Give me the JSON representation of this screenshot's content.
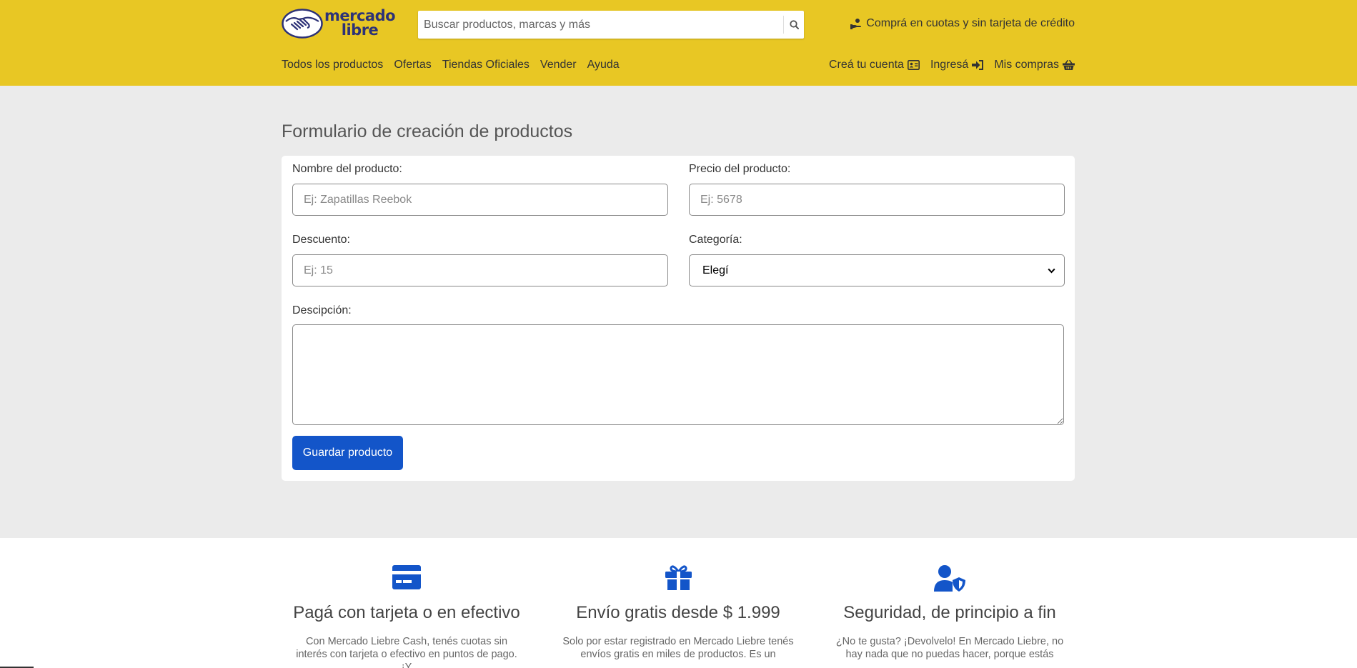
{
  "header": {
    "logo_line1": "mercado",
    "logo_line2": "libre",
    "search_placeholder": "Buscar productos, marcas y más",
    "promo_text": "Comprá en cuotas y sin tarjeta de crédito",
    "nav_left": [
      "Todos los productos",
      "Ofertas",
      "Tiendas Oficiales",
      "Vender",
      "Ayuda"
    ],
    "nav_right": {
      "create_account": "Creá tu cuenta",
      "login": "Ingresá",
      "purchases": "Mis compras"
    },
    "bg_color": "#e8c724"
  },
  "main": {
    "title": "Formulario de creación de productos",
    "form": {
      "name_label": "Nombre del producto:",
      "name_placeholder": "Ej: Zapatillas Reebok",
      "price_label": "Precio del producto:",
      "price_placeholder": "Ej: 5678",
      "discount_label": "Descuento:",
      "discount_placeholder": "Ej: 15",
      "category_label": "Categoría:",
      "category_value": "Elegí",
      "description_label": "Descipción:",
      "save_label": "Guardar producto"
    },
    "accent_color": "#1355c9"
  },
  "features": [
    {
      "icon": "credit-card-icon",
      "title": "Pagá con tarjeta o en efectivo",
      "text": "Con Mercado Liebre Cash, tenés cuotas sin interés con tarjeta o efectivo en puntos de pago. ¡Y"
    },
    {
      "icon": "gift-icon",
      "title": "Envío gratis desde $ 1.999",
      "text": "Solo por estar registrado en Mercado Liebre tenés envíos gratis en miles de productos. Es un"
    },
    {
      "icon": "user-shield-icon",
      "title": "Seguridad, de principio a fin",
      "text": "¿No te gusta? ¡Devolvelo! En Mercado Liebre, no hay nada que no puedas hacer, porque estás"
    }
  ]
}
